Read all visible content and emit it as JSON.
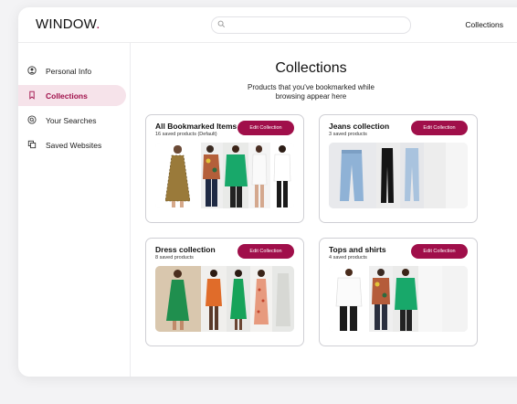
{
  "app": {
    "logo_text": "WINDOW",
    "logo_dot": "."
  },
  "header": {
    "search_placeholder": "",
    "collections_link": "Collections"
  },
  "sidebar": {
    "items": [
      {
        "label": "Personal Info",
        "icon": "user-circle-icon",
        "active": false
      },
      {
        "label": "Collections",
        "icon": "bookmark-icon",
        "active": true
      },
      {
        "label": "Your Searches",
        "icon": "search-history-icon",
        "active": false
      },
      {
        "label": "Saved Websites",
        "icon": "copy-icon",
        "active": false
      }
    ]
  },
  "main": {
    "title": "Collections",
    "subtitle": "Products that you've bookmarked while browsing appear here"
  },
  "collections": [
    {
      "name": "All Bookmarked Items",
      "count": "16 saved products (Default)",
      "edit_label": "Edit Collection"
    },
    {
      "name": "Jeans collection",
      "count": "3 saved products",
      "edit_label": "Edit Collection"
    },
    {
      "name": "Dress collection",
      "count": "8 saved products",
      "edit_label": "Edit Collection"
    },
    {
      "name": "Tops and shirts",
      "count": "4 saved products",
      "edit_label": "Edit Collection"
    }
  ],
  "colors": {
    "accent": "#a00f4a",
    "active_bg": "#f6e3ea"
  }
}
